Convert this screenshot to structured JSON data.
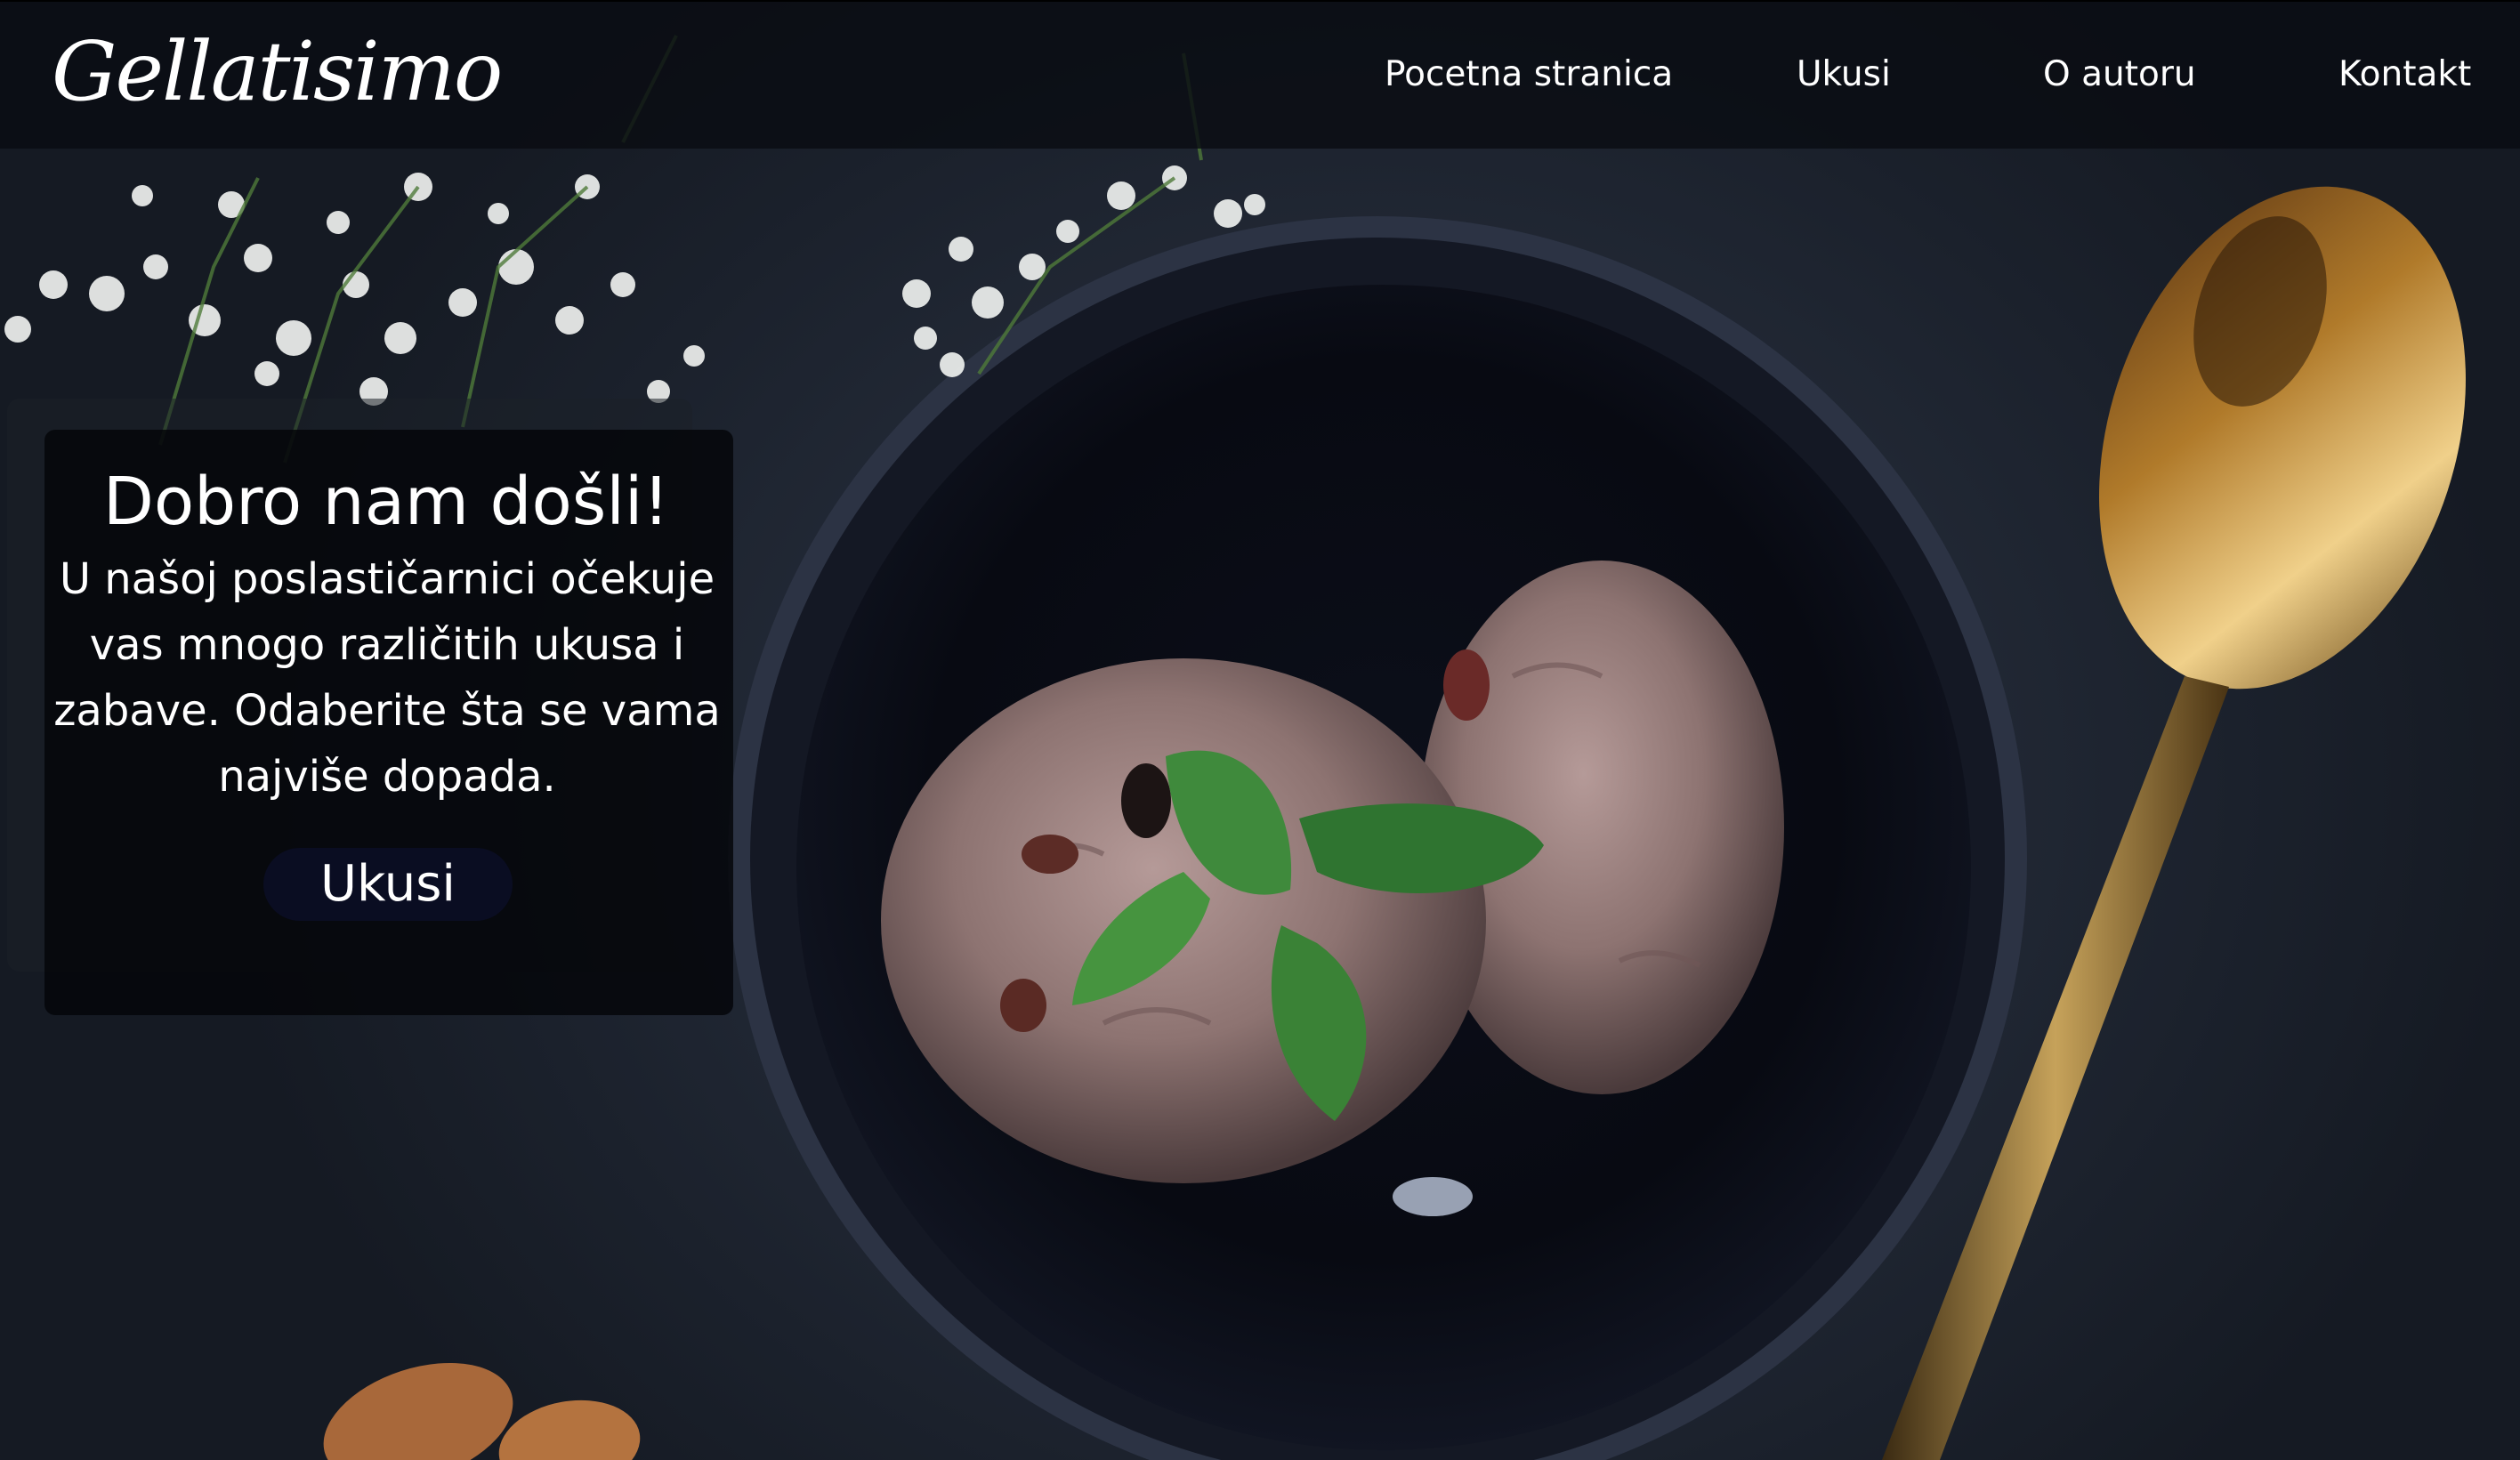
{
  "brand": {
    "logo_text": "Gellatisimo"
  },
  "nav": {
    "items": [
      {
        "label": "Pocetna stranica"
      },
      {
        "label": "Ukusi"
      },
      {
        "label": "O autoru"
      },
      {
        "label": "Kontakt"
      }
    ]
  },
  "welcome": {
    "title": "Dobro nam došli!",
    "text": "U našoj poslastičarnici očekuje vas mnogo različitih ukusa i zabave. Odaberite šta se vama najviše dopada.",
    "button_label": "Ukusi"
  },
  "colors": {
    "navbar_bg": "#0a0c12",
    "button_bg": "#0a0d22",
    "text": "#ffffff"
  }
}
